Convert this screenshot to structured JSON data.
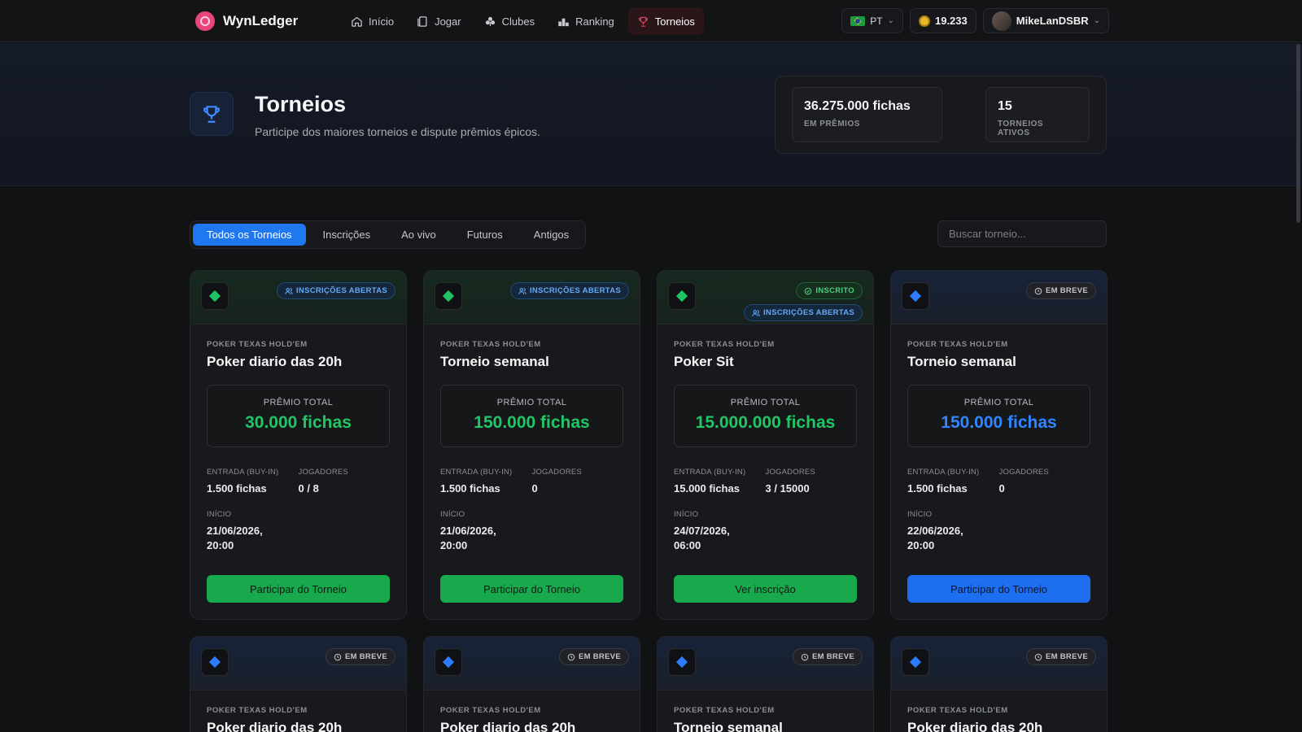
{
  "brand": {
    "name": "WynLedger"
  },
  "nav": [
    {
      "label": "Início",
      "icon": "home-icon",
      "active": false
    },
    {
      "label": "Jogar",
      "icon": "cards-icon",
      "active": false
    },
    {
      "label": "Clubes",
      "icon": "clubs-icon",
      "active": false
    },
    {
      "label": "Ranking",
      "icon": "podium-icon",
      "active": false
    },
    {
      "label": "Torneios",
      "icon": "trophy-icon",
      "active": true
    }
  ],
  "header": {
    "language": "PT",
    "balance": "19.233",
    "username": "MikeLanDSBR"
  },
  "hero": {
    "title": "Torneios",
    "subtitle": "Participe dos maiores torneios e dispute prêmios épicos.",
    "stats": [
      {
        "value": "36.275.000 fichas",
        "label": "EM PRÊMIOS"
      },
      {
        "value": "15",
        "label": "TORNEIOS ATIVOS"
      }
    ]
  },
  "tabs": [
    {
      "label": "Todos os Torneios",
      "active": true
    },
    {
      "label": "Inscrições",
      "active": false
    },
    {
      "label": "Ao vivo",
      "active": false
    },
    {
      "label": "Futuros",
      "active": false
    },
    {
      "label": "Antigos",
      "active": false
    }
  ],
  "search": {
    "placeholder": "Buscar torneio..."
  },
  "labels": {
    "prize": "PRÊMIO TOTAL",
    "buyin": "ENTRADA (BUY-IN)",
    "players": "JOGADORES",
    "start": "INÍCIO"
  },
  "colors": {
    "accent_blue": "#1f78f0",
    "accent_green": "#19a94d",
    "active_nav": "#e23d5b"
  },
  "tournaments": [
    {
      "theme": "green",
      "badges": [
        {
          "type": "open",
          "label": "INSCRIÇÕES ABERTAS"
        }
      ],
      "game": "POKER TEXAS HOLD'EM",
      "name": "Poker diario das 20h",
      "prize": "30.000 fichas",
      "buyin": "1.500 fichas",
      "players": "0 / 8",
      "start": "21/06/2026, 20:00",
      "cta": "Participar do Torneio"
    },
    {
      "theme": "green",
      "badges": [
        {
          "type": "open",
          "label": "INSCRIÇÕES ABERTAS"
        }
      ],
      "game": "POKER TEXAS HOLD'EM",
      "name": "Torneio semanal",
      "prize": "150.000 fichas",
      "buyin": "1.500 fichas",
      "players": "0",
      "start": "21/06/2026, 20:00",
      "cta": "Participar do Torneio"
    },
    {
      "theme": "green",
      "badges": [
        {
          "type": "enrolled",
          "label": "INSCRITO"
        },
        {
          "type": "open",
          "label": "INSCRIÇÕES ABERTAS"
        }
      ],
      "game": "POKER TEXAS HOLD'EM",
      "name": "Poker Sit",
      "prize": "15.000.000 fichas",
      "buyin": "15.000 fichas",
      "players": "3 / 15000",
      "start": "24/07/2026, 06:00",
      "cta": "Ver inscrição"
    },
    {
      "theme": "blue",
      "badges": [
        {
          "type": "soon",
          "label": "EM BREVE"
        }
      ],
      "game": "POKER TEXAS HOLD'EM",
      "name": "Torneio semanal",
      "prize": "150.000 fichas",
      "buyin": "1.500 fichas",
      "players": "0",
      "start": "22/06/2026, 20:00",
      "cta": "Participar do Torneio"
    },
    {
      "theme": "blue",
      "badges": [
        {
          "type": "soon",
          "label": "EM BREVE"
        }
      ],
      "game": "POKER TEXAS HOLD'EM",
      "name": "Poker diario das 20h"
    },
    {
      "theme": "blue",
      "badges": [
        {
          "type": "soon",
          "label": "EM BREVE"
        }
      ],
      "game": "POKER TEXAS HOLD'EM",
      "name": "Poker diario das 20h"
    },
    {
      "theme": "blue",
      "badges": [
        {
          "type": "soon",
          "label": "EM BREVE"
        }
      ],
      "game": "POKER TEXAS HOLD'EM",
      "name": "Torneio semanal"
    },
    {
      "theme": "blue",
      "badges": [
        {
          "type": "soon",
          "label": "EM BREVE"
        }
      ],
      "game": "POKER TEXAS HOLD'EM",
      "name": "Poker diario das 20h"
    }
  ]
}
